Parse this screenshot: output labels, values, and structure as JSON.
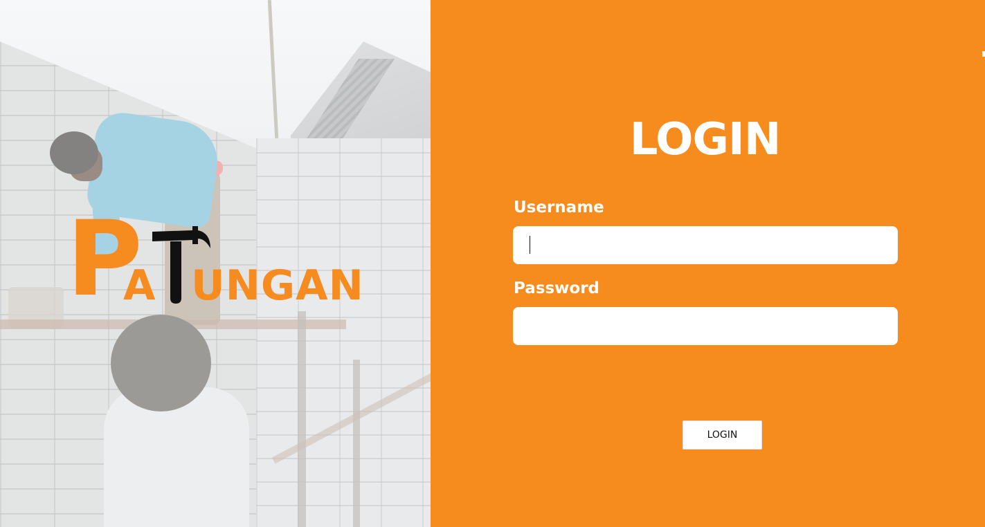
{
  "brand": {
    "logo_text_big": "P",
    "logo_text_a": "A",
    "logo_text_rest": "UNGAN",
    "logo_full": "PATUNGAN",
    "logo_color": "#f68b1f",
    "logo_icon": "hammer-icon"
  },
  "login": {
    "title": "LOGIN",
    "username_label": "Username",
    "username_value": "",
    "password_label": "Password",
    "password_value": "",
    "button_label": "LOGIN"
  },
  "colors": {
    "panel_background": "#f78c1e",
    "field_background": "#ffffff",
    "text_on_panel": "#ffffff"
  }
}
